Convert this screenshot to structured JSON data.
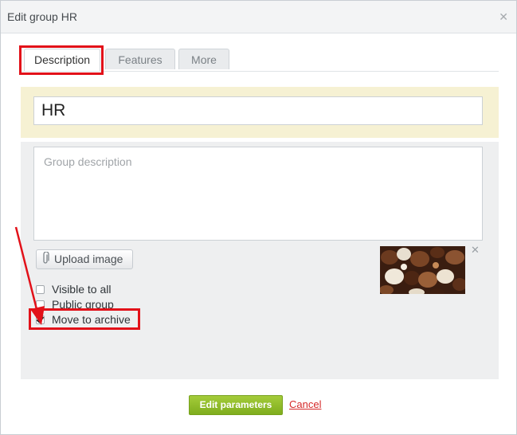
{
  "dialog": {
    "title": "Edit group HR",
    "close_icon": "close-icon"
  },
  "tabs": [
    {
      "label": "Description",
      "active": true
    },
    {
      "label": "Features",
      "active": false
    },
    {
      "label": "More",
      "active": false
    }
  ],
  "form": {
    "group_name": "HR",
    "description_placeholder": "Group description",
    "description_value": "",
    "upload_label": "Upload image",
    "checkboxes": [
      {
        "label": "Visible to all",
        "checked": false
      },
      {
        "label": "Public group",
        "checked": false
      },
      {
        "label": "Move to archive",
        "checked": true
      }
    ]
  },
  "footer": {
    "submit_label": "Edit parameters",
    "cancel_label": "Cancel"
  },
  "colors": {
    "highlight": "#e21119",
    "submit_green": "#8ab92d",
    "name_panel": "#f6f1d3",
    "cancel_link": "#d52a2a"
  }
}
